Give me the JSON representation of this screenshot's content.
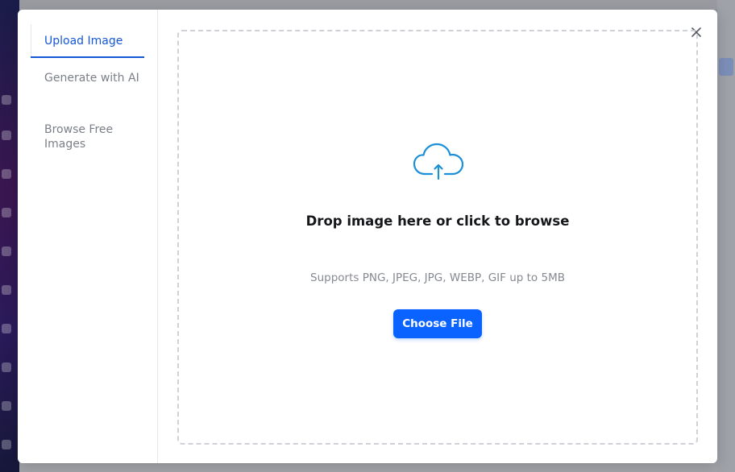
{
  "tabs": [
    {
      "label": "Upload Image",
      "active": true
    },
    {
      "label": "Generate with AI",
      "active": false
    },
    {
      "label": "Browse Free Images",
      "active": false
    }
  ],
  "dropzone": {
    "title": "Drop image here or click to browse",
    "subtitle": "Supports PNG, JPEG, JPG, WEBP, GIF up to 5MB",
    "button_label": "Choose File",
    "icon": "cloud-upload-icon"
  },
  "close_icon": "close-icon",
  "colors": {
    "accent": "#0a63ff",
    "active_tab": "#1557d6",
    "icon_blue": "#1b8fd8",
    "muted_text": "#7b7f88"
  }
}
